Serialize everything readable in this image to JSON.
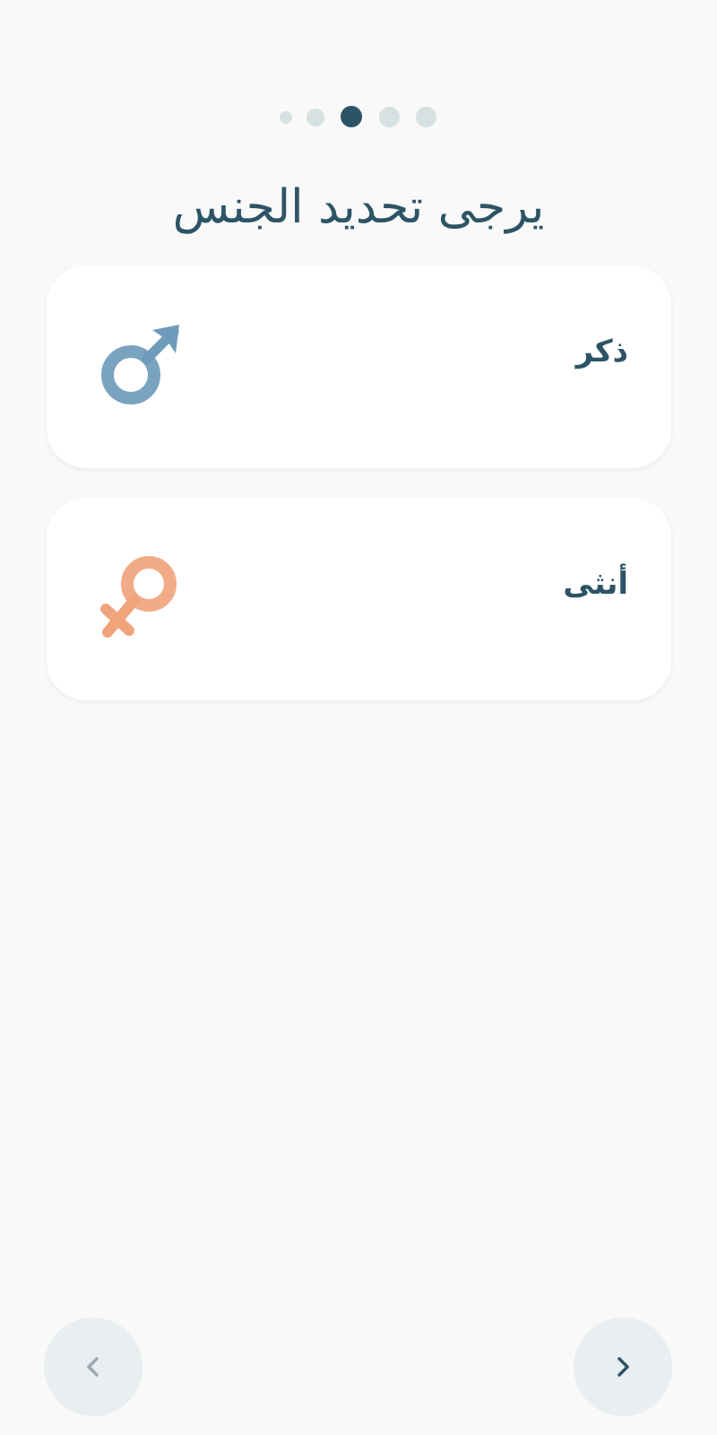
{
  "pager": {
    "total": 5,
    "current_index": 2,
    "active_color": "#2d5466",
    "inactive_color": "#d5e2e1"
  },
  "title": "يرجى تحديد الجنس",
  "options": [
    {
      "label": "ذكر",
      "icon": "male-symbol-icon",
      "icon_color": "#6f9bbb"
    },
    {
      "label": "أنثى",
      "icon": "female-symbol-icon",
      "icon_color": "#f0a47c"
    }
  ],
  "navigation": {
    "back_icon": "chevron-left-icon",
    "next_icon": "chevron-right-icon"
  }
}
